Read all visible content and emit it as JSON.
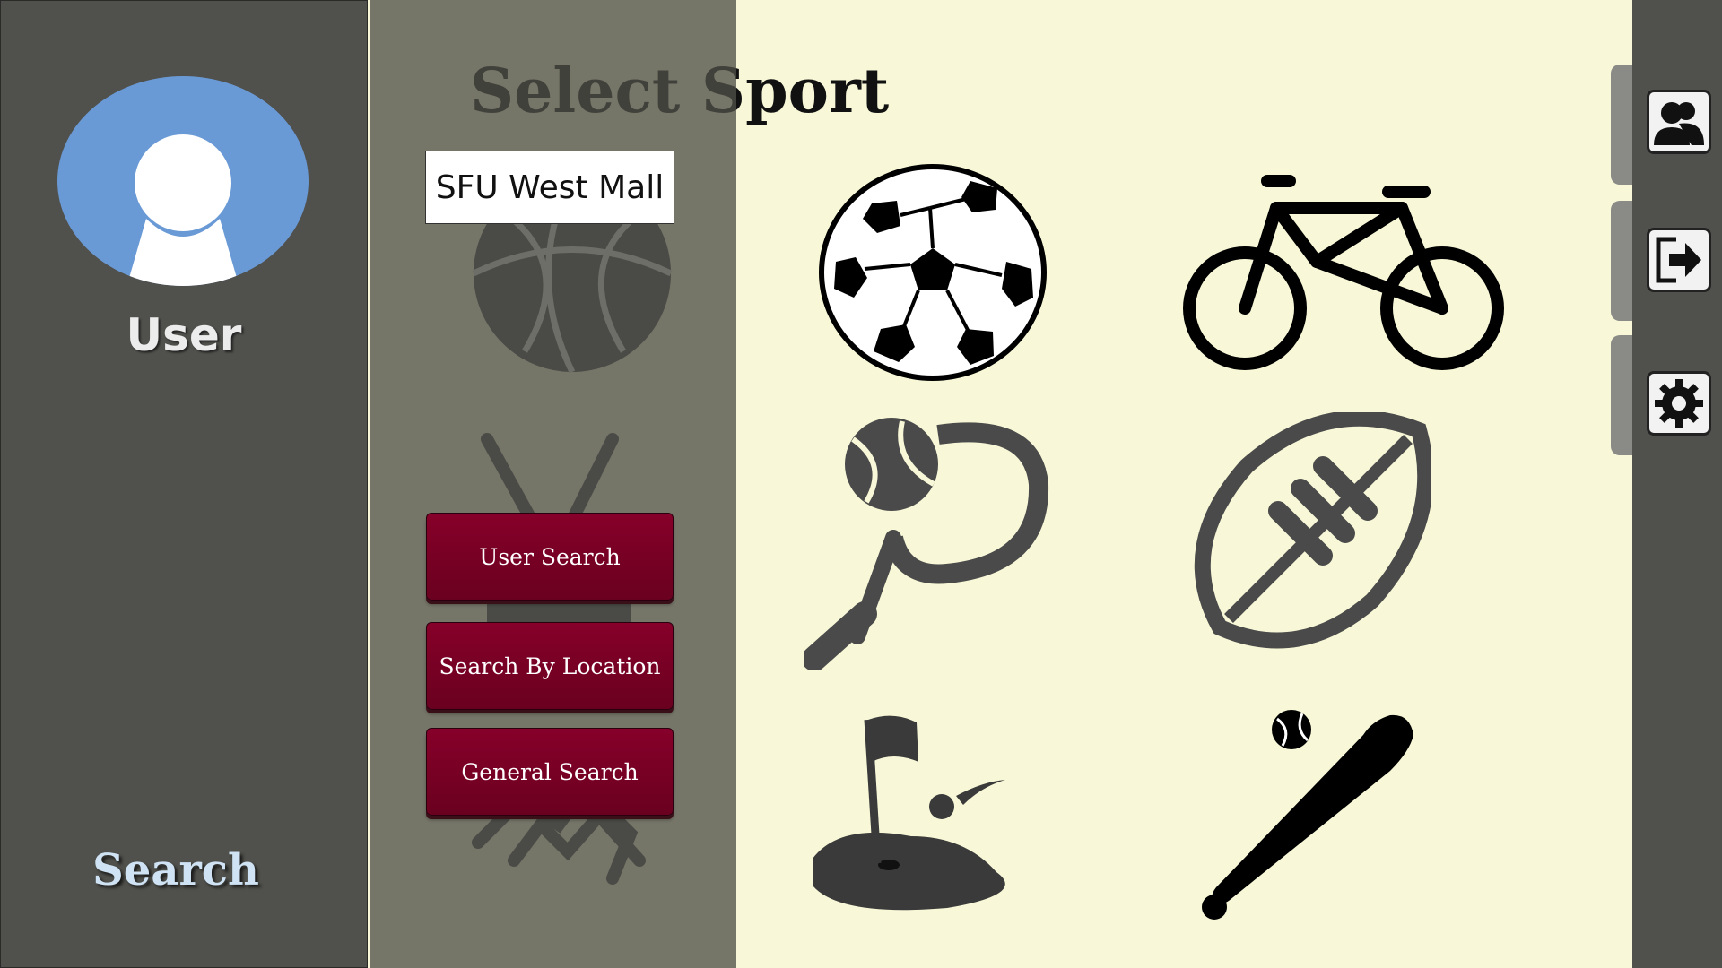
{
  "user": {
    "name": "User"
  },
  "sidebar": {
    "search_label": "Search"
  },
  "page": {
    "title": "Select Sport"
  },
  "location": {
    "value": "SFU West Mall"
  },
  "search_buttons": {
    "user_search": "User Search",
    "search_by_location": "Search By Location",
    "general_search": "General Search"
  },
  "sports": [
    {
      "icon": "soccer-ball-icon"
    },
    {
      "icon": "bicycle-icon"
    },
    {
      "icon": "tennis-icon"
    },
    {
      "icon": "football-icon"
    },
    {
      "icon": "golf-icon"
    },
    {
      "icon": "baseball-icon"
    }
  ],
  "right_rail": [
    {
      "icon": "profile-icon"
    },
    {
      "icon": "logout-icon"
    },
    {
      "icon": "settings-icon"
    }
  ],
  "colors": {
    "sidebar": "#50504c",
    "background": "#f8f8d8",
    "button": "#7a0024",
    "avatar": "#6a9ad6"
  }
}
